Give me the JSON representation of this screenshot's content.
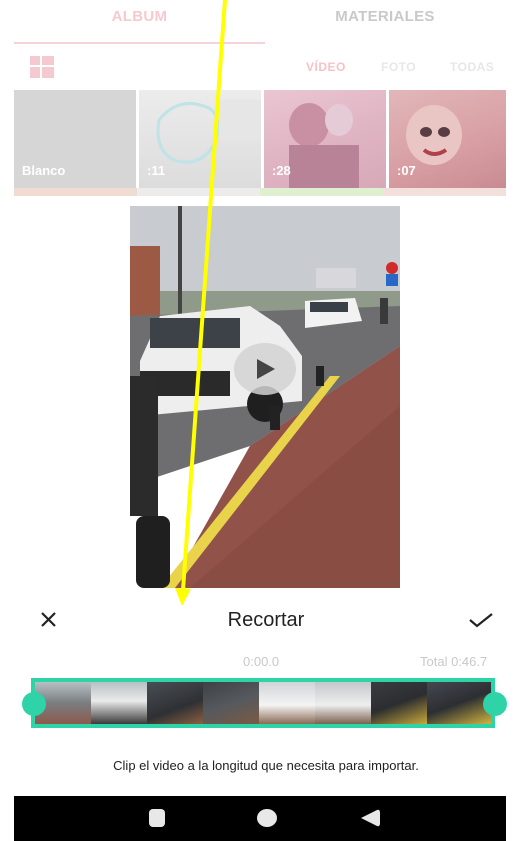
{
  "tabs": {
    "album": "ALBUM",
    "materiales": "MATERIALES"
  },
  "filters": {
    "video": "VÍDEO",
    "foto": "FOTO",
    "todas": "TODAS"
  },
  "thumbnails": [
    {
      "label": "Blanco"
    },
    {
      "label": ":11"
    },
    {
      "label": ":28"
    },
    {
      "label": ":07"
    }
  ],
  "trim": {
    "title": "Recortar",
    "time_start": "0:00.0",
    "time_total": "Total 0:46.7",
    "hint": "Clip el video a la longitud que necesita para importar."
  },
  "colors": {
    "accent": "#2ed3a8",
    "annotation_arrow": "#ffff00",
    "album_tab": "#f6c9cf"
  },
  "icons": {
    "close": "close-icon",
    "confirm": "checkmark-icon",
    "play": "play-icon",
    "layout": "grid-layout-icon",
    "recents": "square-recents-icon",
    "home": "circle-home-icon",
    "back": "triangle-back-icon"
  }
}
